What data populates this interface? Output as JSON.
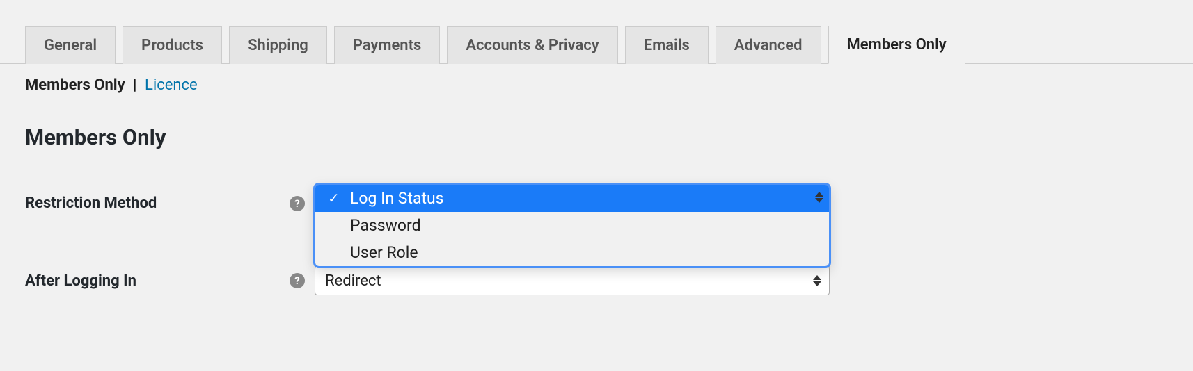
{
  "tabs": [
    {
      "label": "General",
      "active": false
    },
    {
      "label": "Products",
      "active": false
    },
    {
      "label": "Shipping",
      "active": false
    },
    {
      "label": "Payments",
      "active": false
    },
    {
      "label": "Accounts & Privacy",
      "active": false
    },
    {
      "label": "Emails",
      "active": false
    },
    {
      "label": "Advanced",
      "active": false
    },
    {
      "label": "Members Only",
      "active": true
    }
  ],
  "subnav": {
    "current": "Members Only",
    "sep": "|",
    "link": "Licence"
  },
  "heading": "Members Only",
  "help_glyph": "?",
  "fields": {
    "restriction_method": {
      "label": "Restriction Method",
      "options": [
        {
          "label": "Log In Status",
          "selected": true
        },
        {
          "label": "Password",
          "selected": false
        },
        {
          "label": "User Role",
          "selected": false
        }
      ],
      "checkmark": "✓"
    },
    "after_logging_in": {
      "label": "After Logging In",
      "value": "Redirect"
    }
  }
}
